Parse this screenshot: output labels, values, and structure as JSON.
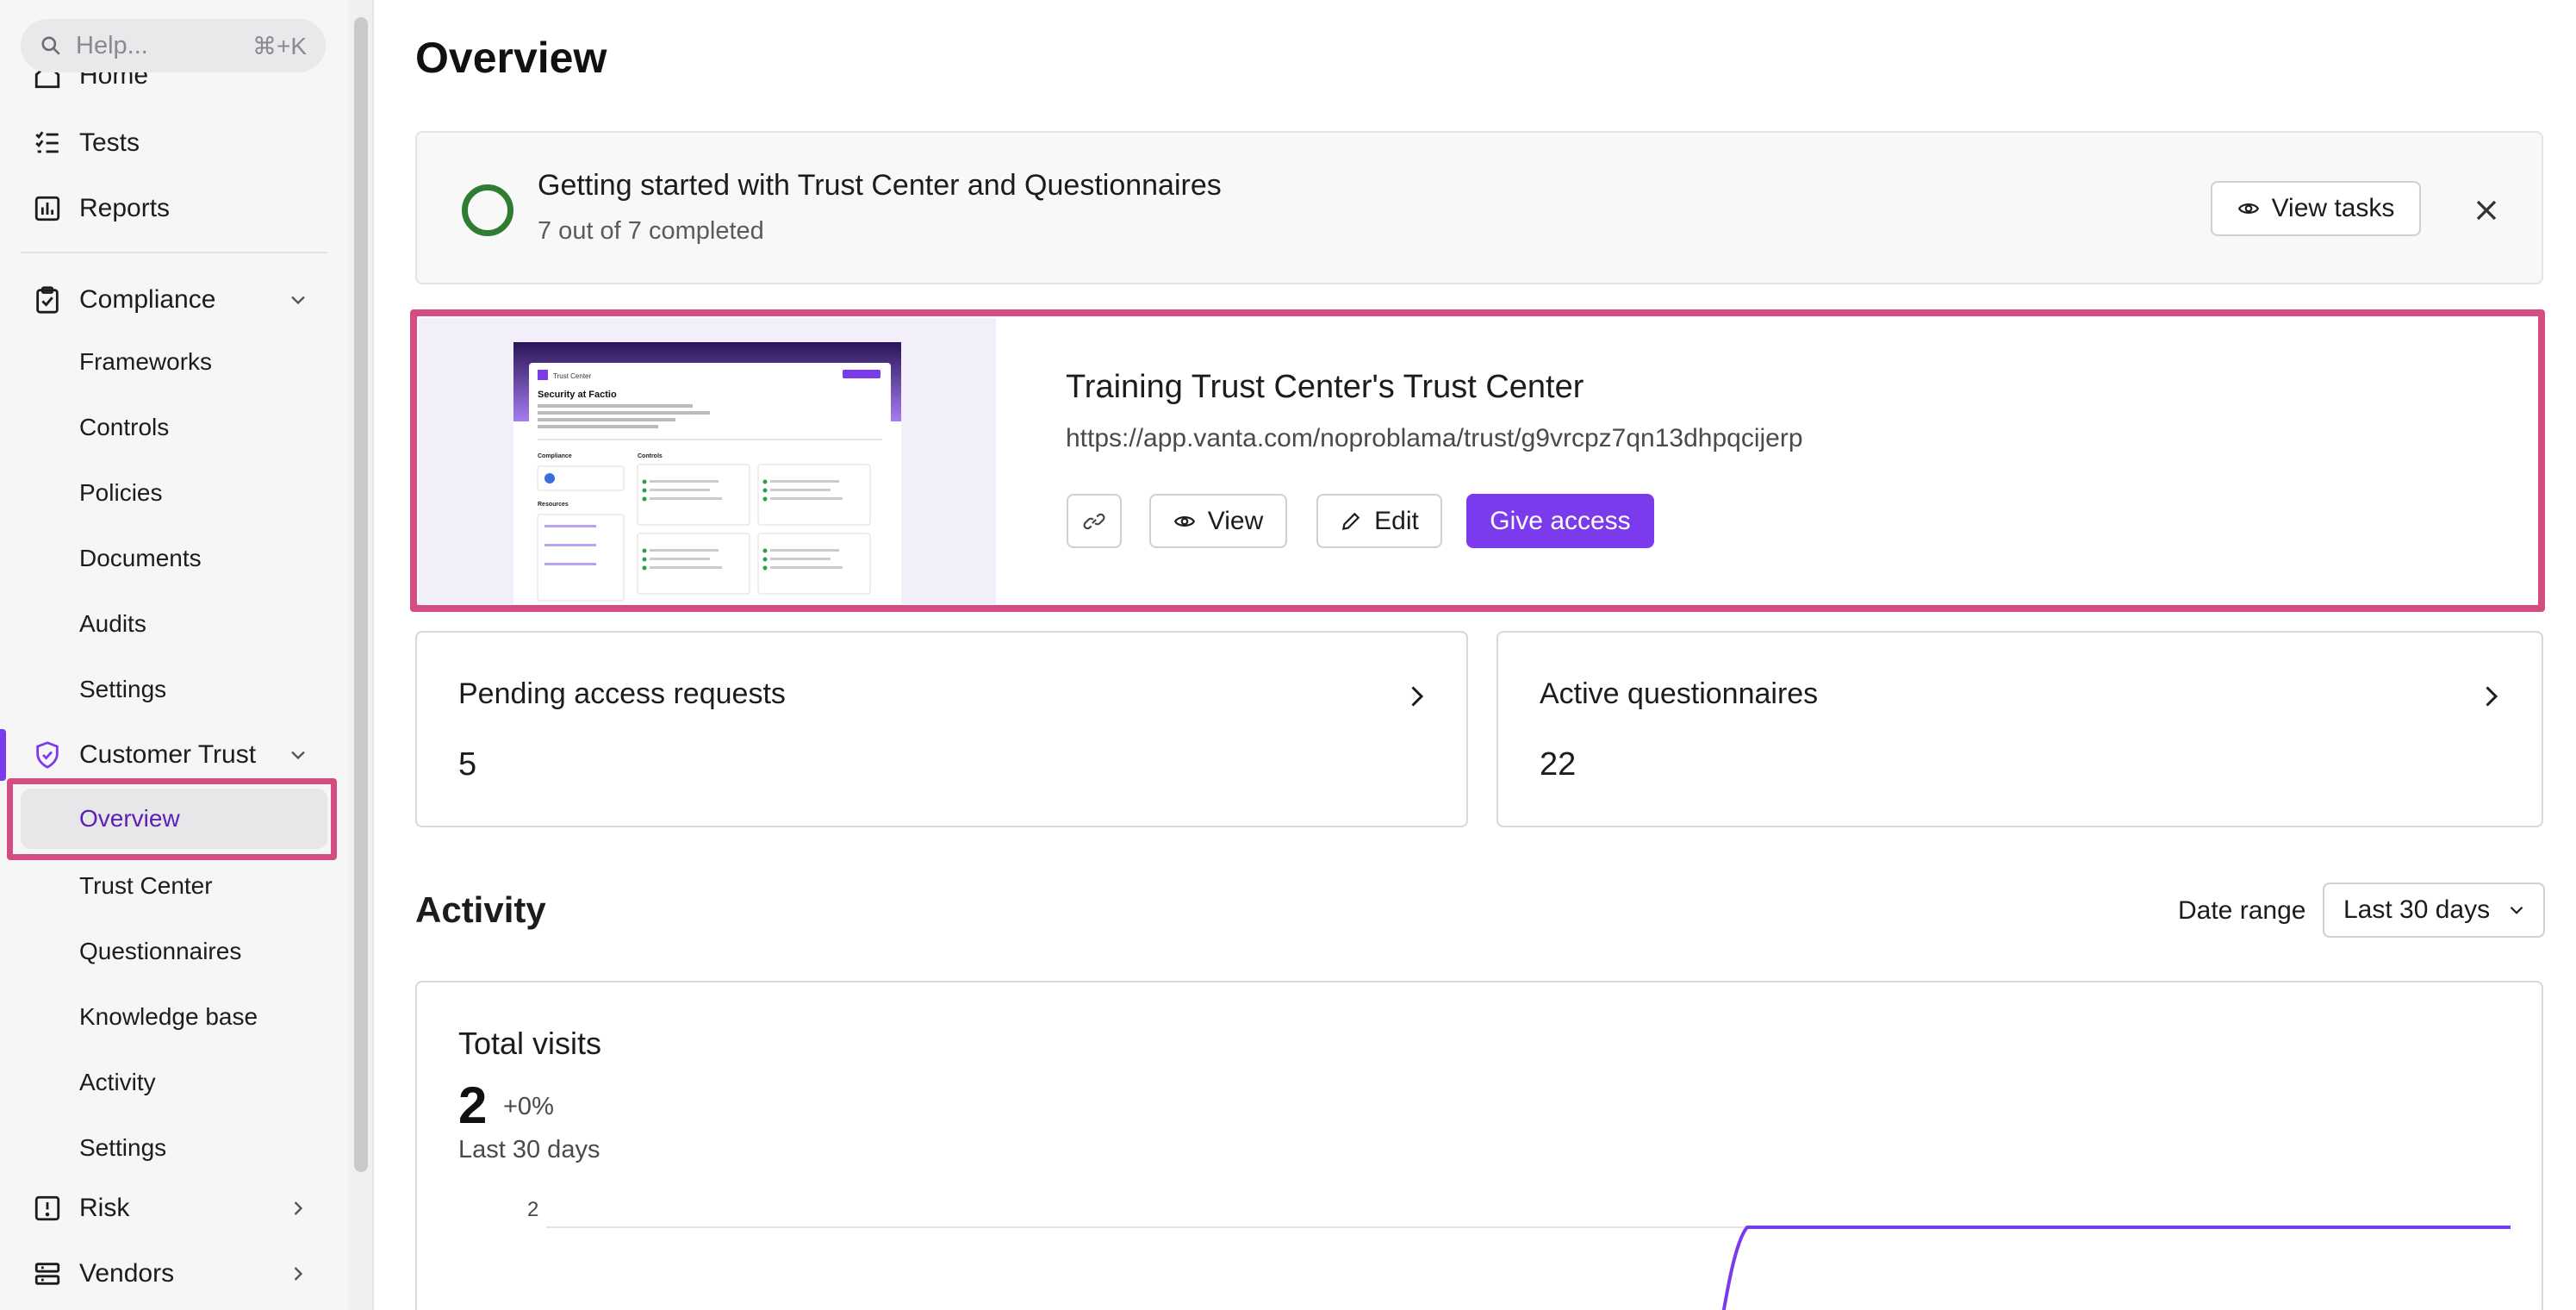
{
  "sidebar": {
    "search": {
      "placeholder": "Help...",
      "shortcut": "⌘+K"
    },
    "top_items": [
      {
        "label": "Home",
        "icon": "home-icon"
      },
      {
        "label": "Tests",
        "icon": "tests-icon"
      },
      {
        "label": "Reports",
        "icon": "reports-icon"
      }
    ],
    "compliance": {
      "label": "Compliance",
      "icon": "clipboard-check-icon",
      "children": [
        "Frameworks",
        "Controls",
        "Policies",
        "Documents",
        "Audits",
        "Settings"
      ]
    },
    "customer_trust": {
      "label": "Customer Trust",
      "icon": "shield-check-icon",
      "children": [
        "Overview",
        "Trust Center",
        "Questionnaires",
        "Knowledge base",
        "Activity",
        "Settings"
      ],
      "selected": "Overview"
    },
    "bottom_items": [
      {
        "label": "Risk",
        "icon": "alert-square-icon"
      },
      {
        "label": "Vendors",
        "icon": "vendors-icon"
      }
    ]
  },
  "main": {
    "title": "Overview",
    "getting_started": {
      "title": "Getting started with Trust Center and Questionnaires",
      "progress_text": "7 out of 7 completed",
      "completed": 7,
      "total": 7,
      "view_tasks_label": "View tasks"
    },
    "trust_center": {
      "name": "Training Trust Center's Trust Center",
      "url": "https://app.vanta.com/noproblama/trust/g9vrcpz7qn13dhpqcijerp",
      "buttons": {
        "view": "View",
        "edit": "Edit",
        "give_access": "Give access"
      },
      "thumbnail": {
        "app_name": "Trust Center",
        "heading": "Security at Factio",
        "section_compliance": "Compliance",
        "section_controls": "Controls",
        "section_resources": "Resources"
      }
    },
    "stats": [
      {
        "title": "Pending access requests",
        "value": "5"
      },
      {
        "title": "Active questionnaires",
        "value": "22"
      }
    ],
    "activity": {
      "title": "Activity",
      "date_range_label": "Date range",
      "date_range_value": "Last 30 days"
    },
    "visits": {
      "title": "Total visits",
      "value": "2",
      "change": "+0%",
      "period": "Last 30 days",
      "y_tick": "2"
    }
  },
  "colors": {
    "accent": "#7c3aed",
    "highlight": "#d44d82",
    "success": "#2e7d32"
  }
}
